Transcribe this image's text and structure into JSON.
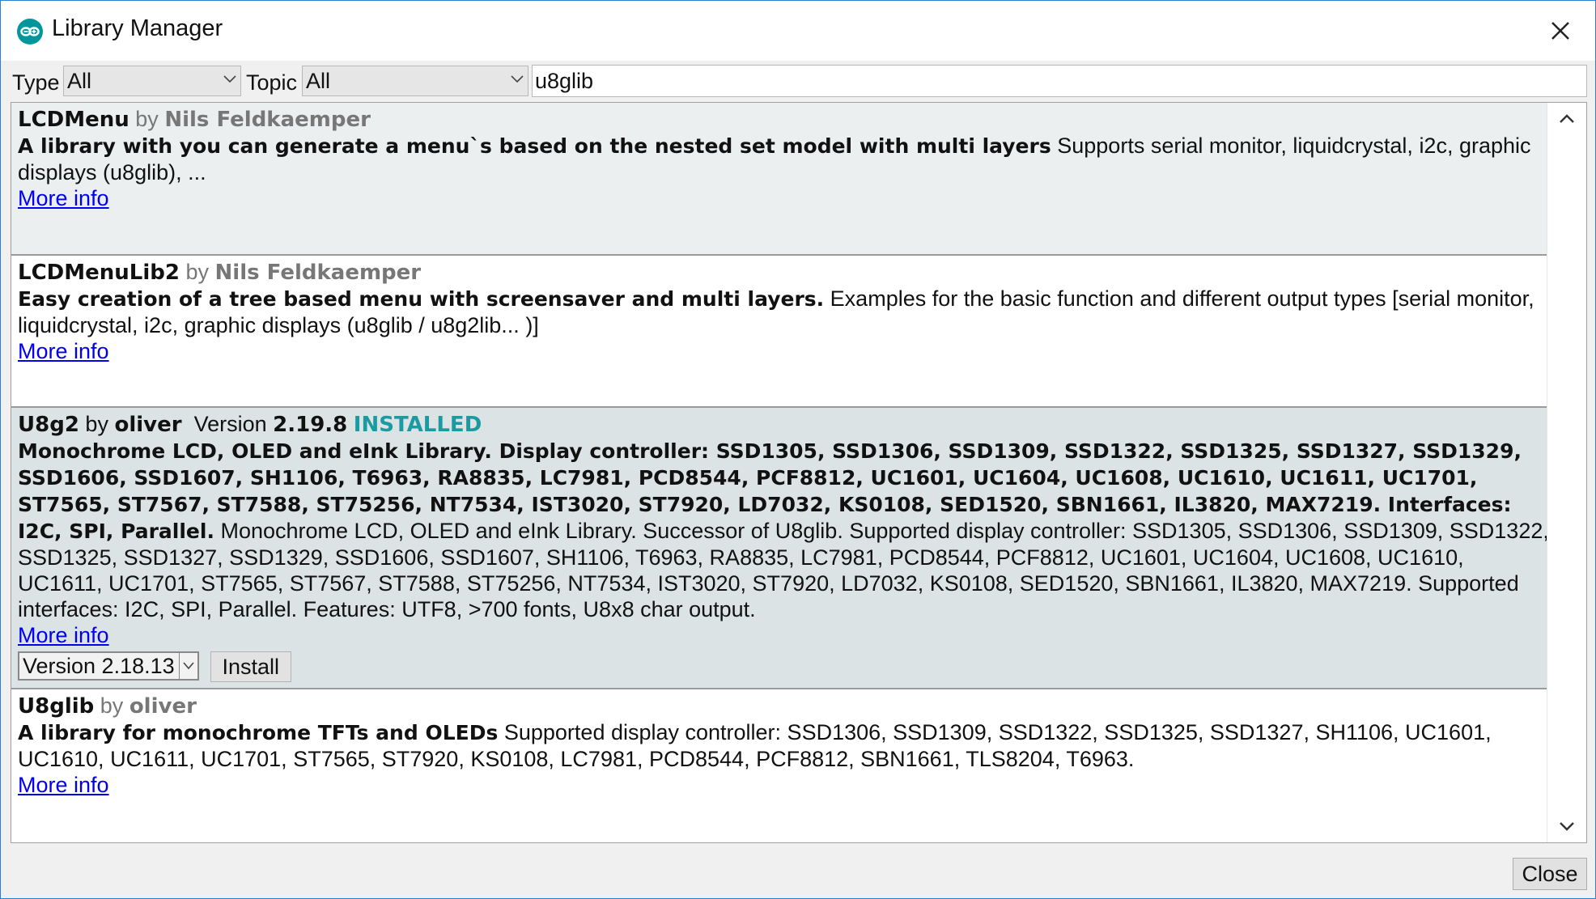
{
  "window": {
    "title": "Library Manager"
  },
  "filters": {
    "type_label": "Type",
    "type_value": "All",
    "topic_label": "Topic",
    "topic_value": "All",
    "search_value": "u8glib"
  },
  "libraries": [
    {
      "name": "LCDMenu",
      "by": "by",
      "author": "Nils Feldkaemper",
      "summary": "A library with you can generate a menu`s based on the nested set model with multi layers",
      "description": "Supports serial monitor, liquidcrystal, i2c, graphic displays (u8glib), ...",
      "more_info": "More info"
    },
    {
      "name": "LCDMenuLib2",
      "by": "by",
      "author": "Nils Feldkaemper",
      "summary": "Easy creation of a tree based menu with screensaver and multi layers.",
      "description": "Examples for the basic function and different output types [serial monitor, liquidcrystal, i2c, graphic displays (u8glib / u8g2lib... )]",
      "more_info": "More info"
    },
    {
      "name": "U8g2",
      "by": "by",
      "author": "oliver",
      "version_label": "Version",
      "version": "2.19.8",
      "status": "INSTALLED",
      "summary": "Monochrome LCD, OLED and eInk Library. Display controller: SSD1305, SSD1306, SSD1309, SSD1322, SSD1325, SSD1327, SSD1329, SSD1606, SSD1607, SH1106, T6963, RA8835, LC7981, PCD8544, PCF8812, UC1601, UC1604, UC1608, UC1610, UC1611, UC1701, ST7565, ST7567, ST7588, ST75256, NT7534, IST3020, ST7920, LD7032, KS0108, SED1520, SBN1661, IL3820, MAX7219. Interfaces: I2C, SPI, Parallel.",
      "description": "Monochrome LCD, OLED and eInk Library. Successor of U8glib. Supported display controller: SSD1305, SSD1306, SSD1309, SSD1322, SSD1325, SSD1327, SSD1329, SSD1606, SSD1607, SH1106, T6963, RA8835, LC7981, PCD8544, PCF8812, UC1601, UC1604, UC1608, UC1610, UC1611, UC1701, ST7565, ST7567, ST7588, ST75256, NT7534, IST3020, ST7920, LD7032, KS0108, SED1520, SBN1661, IL3820, MAX7219. Supported interfaces: I2C, SPI, Parallel. Features: UTF8, >700 fonts, U8x8 char output.",
      "more_info": "More info",
      "version_select": "Version 2.18.13",
      "install_label": "Install"
    },
    {
      "name": "U8glib",
      "by": "by",
      "author": "oliver",
      "summary": "A library for monochrome TFTs and OLEDs",
      "description": "Supported display controller: SSD1306, SSD1309, SSD1322, SSD1325, SSD1327, SH1106, UC1601, UC1610, UC1611, UC1701, ST7565, ST7920, KS0108, LC7981, PCD8544, PCF8812, SBN1661, TLS8204, T6963.",
      "more_info": "More info"
    }
  ],
  "footer": {
    "close_label": "Close"
  },
  "colors": {
    "accent": "#00979c",
    "installed": "#1a9ba1",
    "link": "#0000ee",
    "window_border": "#2a7fd4"
  },
  "icons": {
    "app": "arduino-logo-icon",
    "close": "close-icon",
    "dropdown": "chevron-down-icon",
    "scroll_up": "chevron-up-icon",
    "scroll_down": "chevron-down-icon"
  }
}
